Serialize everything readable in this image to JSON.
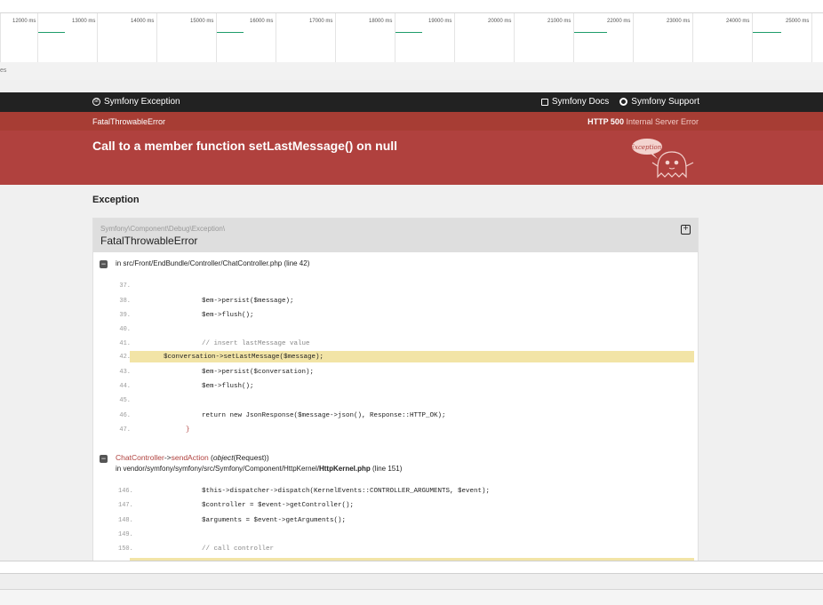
{
  "timeline": {
    "labels": [
      "12000 ms",
      "13000 ms",
      "14000 ms",
      "15000 ms",
      "16000 ms",
      "17000 ms",
      "18000 ms",
      "19000 ms",
      "20000 ms",
      "21000 ms",
      "22000 ms",
      "23000 ms",
      "24000 ms",
      "25000 ms"
    ],
    "mark_color": "#1e9c6a"
  },
  "tl_sub_text": "es",
  "header": {
    "brand": "Symfony Exception",
    "docs": "Symfony Docs",
    "support": "Symfony Support"
  },
  "error": {
    "class_short": "FatalThrowableError",
    "status_code": "HTTP 500",
    "status_text": "Internal Server Error",
    "message": "Call to a member function setLastMessage() on null",
    "ghost_label": "Exception!"
  },
  "section_title": "Exception",
  "trace": {
    "namespace": "Symfony\\Component\\Debug\\Exception\\",
    "class": "FatalThrowableError",
    "frame1": {
      "prefix": "in ",
      "path": "src/Front/EndBundle/Controller/",
      "file": "ChatController.php",
      "line_info": "(line 42)",
      "lines": [
        {
          "n": "37.",
          "code": ""
        },
        {
          "n": "38.",
          "code": "        $em->persist($message);"
        },
        {
          "n": "39.",
          "code": "        $em->flush();"
        },
        {
          "n": "40.",
          "code": ""
        },
        {
          "n": "41.",
          "code": "        // insert lastMessage value"
        },
        {
          "n": "42.",
          "code": "        $conversation->setLastMessage($message);"
        },
        {
          "n": "43.",
          "code": "        $em->persist($conversation);"
        },
        {
          "n": "44.",
          "code": "        $em->flush();"
        },
        {
          "n": "45.",
          "code": ""
        },
        {
          "n": "46.",
          "code": "        return new JsonResponse($message->json(), Response::HTTP_OK);"
        },
        {
          "n": "47.",
          "code": "    }"
        }
      ]
    },
    "frame2": {
      "class": "ChatController",
      "arrow": "->",
      "method": "sendAction",
      "arg_type": "object",
      "arg_class": "(Request)",
      "prefix": "in ",
      "path": "vendor/symfony/symfony/src/Symfony/Component/HttpKernel/",
      "file": "HttpKernel.php",
      "line_info": "(line 151)",
      "lines": [
        {
          "n": "146.",
          "code": "        $this->dispatcher->dispatch(KernelEvents::CONTROLLER_ARGUMENTS, $event);"
        },
        {
          "n": "147.",
          "code": "        $controller = $event->getController();"
        },
        {
          "n": "148.",
          "code": "        $arguments = $event->getArguments();"
        },
        {
          "n": "149.",
          "code": ""
        },
        {
          "n": "150.",
          "code": "        // call controller"
        }
      ]
    }
  }
}
